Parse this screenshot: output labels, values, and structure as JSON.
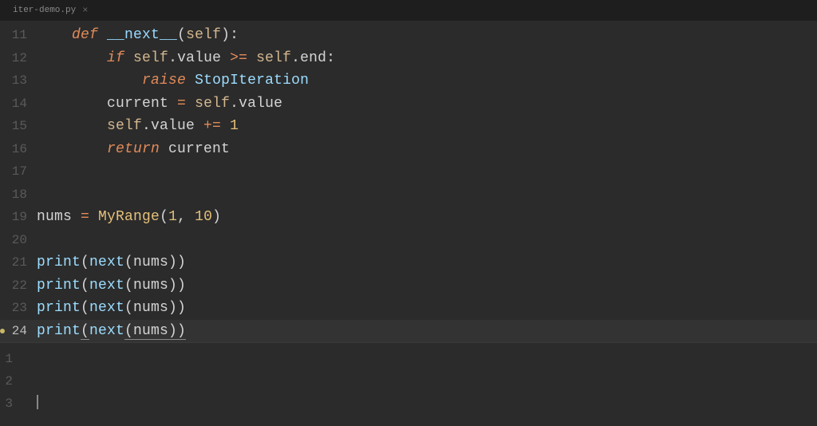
{
  "tab": {
    "filename": "iter-demo.py",
    "close_glyph": "×"
  },
  "editor": {
    "lines": [
      {
        "num": "11",
        "tokens": [
          {
            "t": "    ",
            "c": "plain"
          },
          {
            "t": "def",
            "c": "kw"
          },
          {
            "t": " ",
            "c": "plain"
          },
          {
            "t": "__next__",
            "c": "fn"
          },
          {
            "t": "(",
            "c": "plain"
          },
          {
            "t": "self",
            "c": "param"
          },
          {
            "t": "):",
            "c": "plain"
          }
        ]
      },
      {
        "num": "12",
        "tokens": [
          {
            "t": "        ",
            "c": "plain"
          },
          {
            "t": "if",
            "c": "kw"
          },
          {
            "t": " ",
            "c": "plain"
          },
          {
            "t": "self",
            "c": "param"
          },
          {
            "t": ".value ",
            "c": "plain"
          },
          {
            "t": ">=",
            "c": "op"
          },
          {
            "t": " ",
            "c": "plain"
          },
          {
            "t": "self",
            "c": "param"
          },
          {
            "t": ".end:",
            "c": "plain"
          }
        ]
      },
      {
        "num": "13",
        "tokens": [
          {
            "t": "            ",
            "c": "plain"
          },
          {
            "t": "raise",
            "c": "kw"
          },
          {
            "t": " ",
            "c": "plain"
          },
          {
            "t": "StopIteration",
            "c": "builtin"
          }
        ]
      },
      {
        "num": "14",
        "tokens": [
          {
            "t": "        current ",
            "c": "plain"
          },
          {
            "t": "=",
            "c": "op"
          },
          {
            "t": " ",
            "c": "plain"
          },
          {
            "t": "self",
            "c": "param"
          },
          {
            "t": ".value",
            "c": "plain"
          }
        ]
      },
      {
        "num": "15",
        "tokens": [
          {
            "t": "        ",
            "c": "plain"
          },
          {
            "t": "self",
            "c": "param"
          },
          {
            "t": ".value ",
            "c": "plain"
          },
          {
            "t": "+=",
            "c": "op"
          },
          {
            "t": " ",
            "c": "plain"
          },
          {
            "t": "1",
            "c": "num"
          }
        ]
      },
      {
        "num": "16",
        "tokens": [
          {
            "t": "        ",
            "c": "plain"
          },
          {
            "t": "return",
            "c": "kw"
          },
          {
            "t": " current",
            "c": "plain"
          }
        ]
      },
      {
        "num": "17",
        "tokens": []
      },
      {
        "num": "18",
        "tokens": []
      },
      {
        "num": "19",
        "tokens": [
          {
            "t": "nums ",
            "c": "plain"
          },
          {
            "t": "=",
            "c": "op"
          },
          {
            "t": " ",
            "c": "plain"
          },
          {
            "t": "MyRange",
            "c": "cls"
          },
          {
            "t": "(",
            "c": "plain"
          },
          {
            "t": "1",
            "c": "num"
          },
          {
            "t": ", ",
            "c": "plain"
          },
          {
            "t": "10",
            "c": "num"
          },
          {
            "t": ")",
            "c": "plain"
          }
        ]
      },
      {
        "num": "20",
        "tokens": []
      },
      {
        "num": "21",
        "tokens": [
          {
            "t": "print",
            "c": "builtin"
          },
          {
            "t": "(",
            "c": "plain"
          },
          {
            "t": "next",
            "c": "builtin"
          },
          {
            "t": "(nums))",
            "c": "plain"
          }
        ]
      },
      {
        "num": "22",
        "tokens": [
          {
            "t": "print",
            "c": "builtin"
          },
          {
            "t": "(",
            "c": "plain"
          },
          {
            "t": "next",
            "c": "builtin"
          },
          {
            "t": "(nums))",
            "c": "plain"
          }
        ]
      },
      {
        "num": "23",
        "tokens": [
          {
            "t": "print",
            "c": "builtin"
          },
          {
            "t": "(",
            "c": "plain"
          },
          {
            "t": "next",
            "c": "builtin"
          },
          {
            "t": "(nums))",
            "c": "plain"
          }
        ]
      },
      {
        "num": "24",
        "active": true,
        "marker": true,
        "tokens": [
          {
            "t": "print",
            "c": "builtin"
          },
          {
            "t": "(",
            "c": "plain",
            "u": true
          },
          {
            "t": "next",
            "c": "builtin"
          },
          {
            "t": "(nums))",
            "c": "plain",
            "u": true
          }
        ]
      }
    ]
  },
  "terminal": {
    "lines": [
      {
        "num": "1",
        "text": ""
      },
      {
        "num": "2",
        "text": ""
      },
      {
        "num": "3",
        "text": "",
        "cursor": true
      }
    ]
  }
}
